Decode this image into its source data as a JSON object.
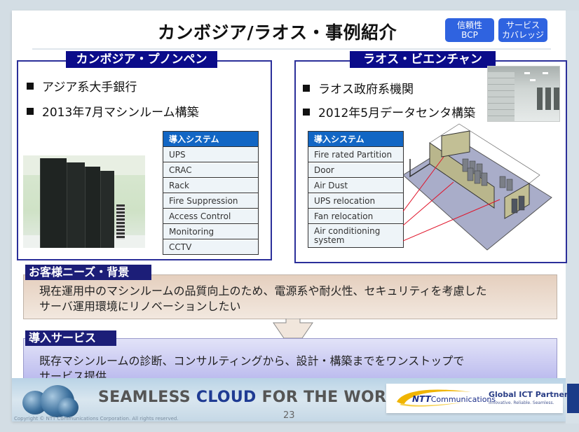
{
  "title": "カンボジア/ラオス・事例紹介",
  "tags": [
    {
      "line1": "信頼性",
      "line2": "BCP"
    },
    {
      "line1": "サービス",
      "line2": "カバレッジ"
    }
  ],
  "left_panel": {
    "label": "カンボジア・プノンペン",
    "bullets": [
      "アジア系大手銀行",
      "2013年7月マシンルーム構築"
    ],
    "table_header": "導入システム",
    "systems": [
      "UPS",
      "CRAC",
      "Rack",
      "Fire Suppression",
      "Access Control",
      "Monitoring",
      "CCTV"
    ]
  },
  "right_panel": {
    "label": "ラオス・ビエンチャン",
    "bullets": [
      "ラオス政府系機関",
      "2012年5月データセンタ構築"
    ],
    "table_header": "導入システム",
    "systems": [
      "Fire rated Partition",
      "Door",
      "Air Dust",
      "UPS relocation",
      "Fan relocation",
      "Air conditioning system"
    ]
  },
  "needs": {
    "label": "お客様ニーズ・背景",
    "text_line1": "現在運用中のマシンルームの品質向上のため、電源系や耐火性、セキュリティを考慮した",
    "text_line2": "サーバ運用環境にリノベーションしたい"
  },
  "service": {
    "label": "導入サービス",
    "text_line1": "既存マシンルームの診断、コンサルティングから、設計・構築までをワンストップで",
    "text_line2": "サービス提供"
  },
  "footer": {
    "slogan_pre": "SEAMLESS ",
    "slogan_hl": "CLOUD",
    "slogan_post": " FOR THE WORLD",
    "page_number": "23",
    "copyright": "Copyright © NTT Communications Corporation. All rights reserved.",
    "brand_ntt": "NTT",
    "brand_comm": "Communications",
    "partner": "Global ICT Partner",
    "partner_sub": "Innovative. Reliable. Seamless."
  },
  "colors": {
    "panel_border": "#2b2f9a",
    "panel_label_bg": "#0b0c8a",
    "tag_bg": "#2f63e0",
    "table_header_bg": "#1266c4",
    "section_label_bg": "#1c1e78",
    "needs_bg": "#e5cfbe",
    "service_bg": "#b3b2ec"
  }
}
